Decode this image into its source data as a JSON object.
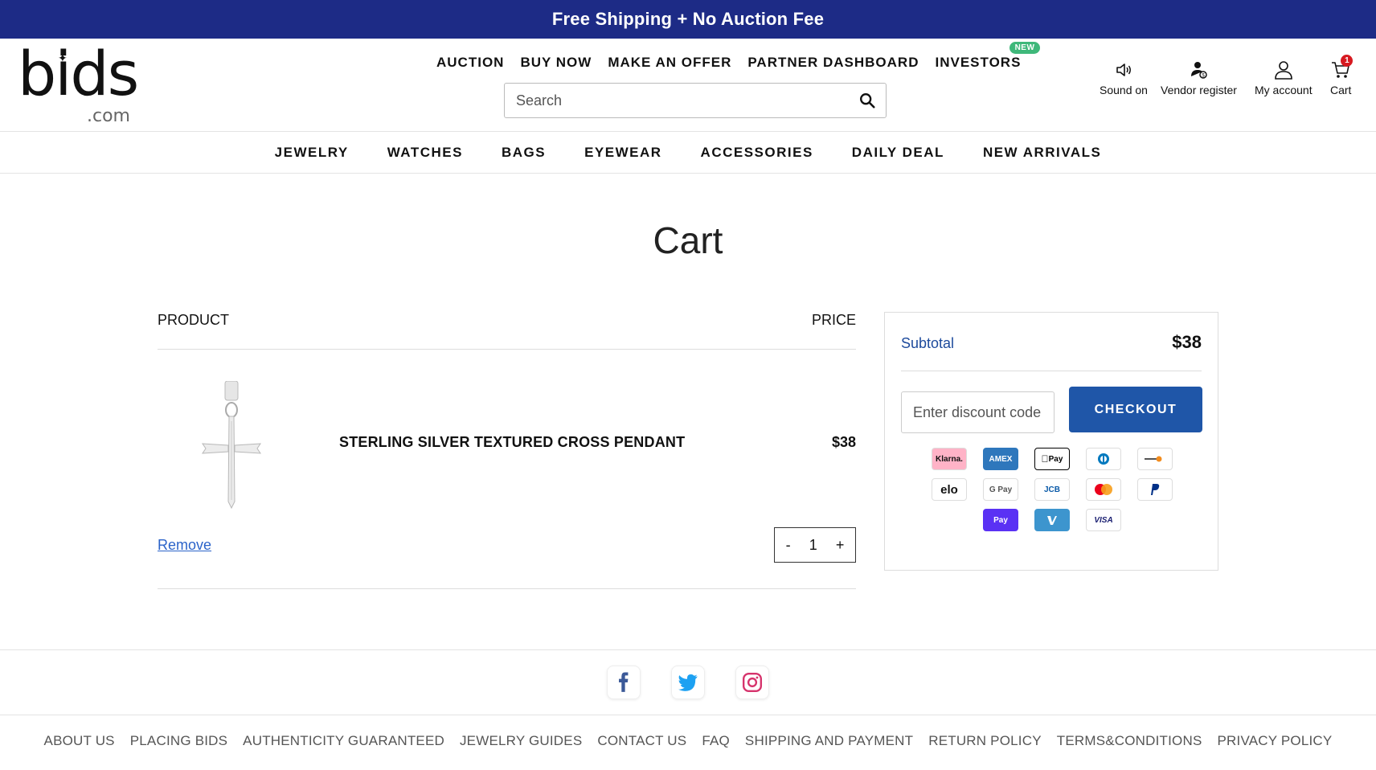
{
  "promo": {
    "text": "Free Shipping + No Auction Fee"
  },
  "logo": {
    "main": "bids",
    "sub": ".com"
  },
  "top_nav": [
    {
      "label": "AUCTION"
    },
    {
      "label": "BUY NOW"
    },
    {
      "label": "MAKE AN OFFER"
    },
    {
      "label": "PARTNER DASHBOARD"
    },
    {
      "label": "INVESTORS",
      "badge": "NEW"
    }
  ],
  "search": {
    "placeholder": "Search"
  },
  "utility": {
    "sound": "Sound on",
    "vendor": "Vendor register",
    "account": "My account",
    "cart": "Cart",
    "cart_count": "1"
  },
  "categories": [
    "JEWELRY",
    "WATCHES",
    "BAGS",
    "EYEWEAR",
    "ACCESSORIES",
    "DAILY DEAL",
    "NEW ARRIVALS"
  ],
  "page_title": "Cart",
  "cart": {
    "col_product": "PRODUCT",
    "col_price": "PRICE",
    "item": {
      "name": "STERLING SILVER TEXTURED CROSS PENDANT",
      "price": "$38",
      "quantity": "1",
      "remove": "Remove",
      "minus": "-",
      "plus": "+"
    }
  },
  "summary": {
    "subtotal_label": "Subtotal",
    "subtotal_value": "$38",
    "discount_placeholder": "Enter discount code",
    "checkout": "CHECKOUT"
  },
  "payment_icons": [
    [
      "klarna",
      "amex",
      "apple-pay",
      "diners",
      "discover"
    ],
    [
      "elo",
      "google-pay",
      "jcb",
      "mastercard",
      "paypal"
    ],
    [
      "shop-pay",
      "venmo",
      "visa"
    ]
  ],
  "payment_labels": {
    "klarna": "Klarna.",
    "amex": "AMEX",
    "apple-pay": "Pay",
    "elo": "elo",
    "google-pay": "G Pay",
    "jcb": "JCB",
    "shop-pay": "Pay",
    "visa": "VISA"
  },
  "social": [
    "facebook",
    "twitter",
    "instagram"
  ],
  "footer_links": [
    "ABOUT US",
    "PLACING BIDS",
    "AUTHENTICITY GUARANTEED",
    "JEWELRY GUIDES",
    "CONTACT US",
    "FAQ",
    "SHIPPING AND PAYMENT",
    "RETURN POLICY",
    "TERMS&CONDITIONS",
    "PRIVACY POLICY"
  ],
  "colors": {
    "promo_bg": "#1d2b86",
    "checkout_bg": "#1f56a8",
    "link": "#2b63c9",
    "badge_new": "#3fb87a",
    "cart_badge": "#d71920"
  }
}
